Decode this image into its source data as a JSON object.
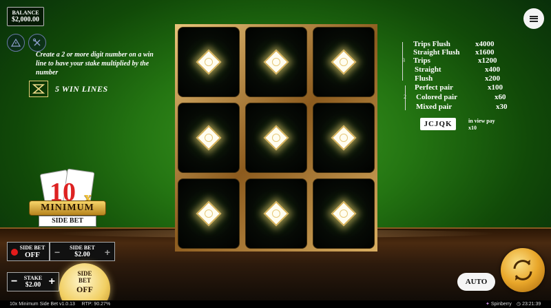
{
  "balance": {
    "label": "BALANCE",
    "value": "$2,000.00"
  },
  "info": {
    "text": "Create a 2 or more digit number on a win line to have your stake multiplied by the number",
    "win_lines": "5 WIN LINES"
  },
  "logo": {
    "ten": "10",
    "x": "x",
    "title": "MINIMUM",
    "subtitle": "SIDE BET"
  },
  "board": {
    "cells": 9,
    "colors": {
      "frame": "#c89a4a",
      "symbol": "#fffdf0"
    }
  },
  "paytable": {
    "rows": [
      {
        "name": "Trips Flush",
        "multiplier": "x4000"
      },
      {
        "name": "Straight Flush",
        "multiplier": "x1600"
      },
      {
        "name": "Trips",
        "multiplier": "x1200"
      },
      {
        "name": "Straight",
        "multiplier": "x400"
      },
      {
        "name": "Flush",
        "multiplier": "x200"
      },
      {
        "name": "Perfect pair",
        "multiplier": "x100"
      },
      {
        "name": "Colored pair",
        "multiplier": "x60"
      },
      {
        "name": "Mixed pair",
        "multiplier": "x30"
      }
    ],
    "bracket_3": "3",
    "bracket_2": "2",
    "cards_icon": "JCJQK",
    "in_view_line1": "in view pay",
    "in_view_line2": "x10"
  },
  "controls": {
    "side_bet_label": "SIDE BET",
    "side_bet_state": "OFF",
    "side_bet_amount_label": "SIDE BET",
    "side_bet_amount": "$2.00",
    "stake_label": "STAKE",
    "stake_value": "$2.00",
    "minus": "−",
    "plus": "+",
    "big_side_bet_label": "SIDE BET",
    "big_side_bet_state": "OFF",
    "auto_label": "AUTO"
  },
  "footer": {
    "game_info": "10x Minimum Side Bet v1.0.13",
    "rtp": "RTP: 90.27%",
    "brand": "Spinberry",
    "time": "23:21:39"
  }
}
